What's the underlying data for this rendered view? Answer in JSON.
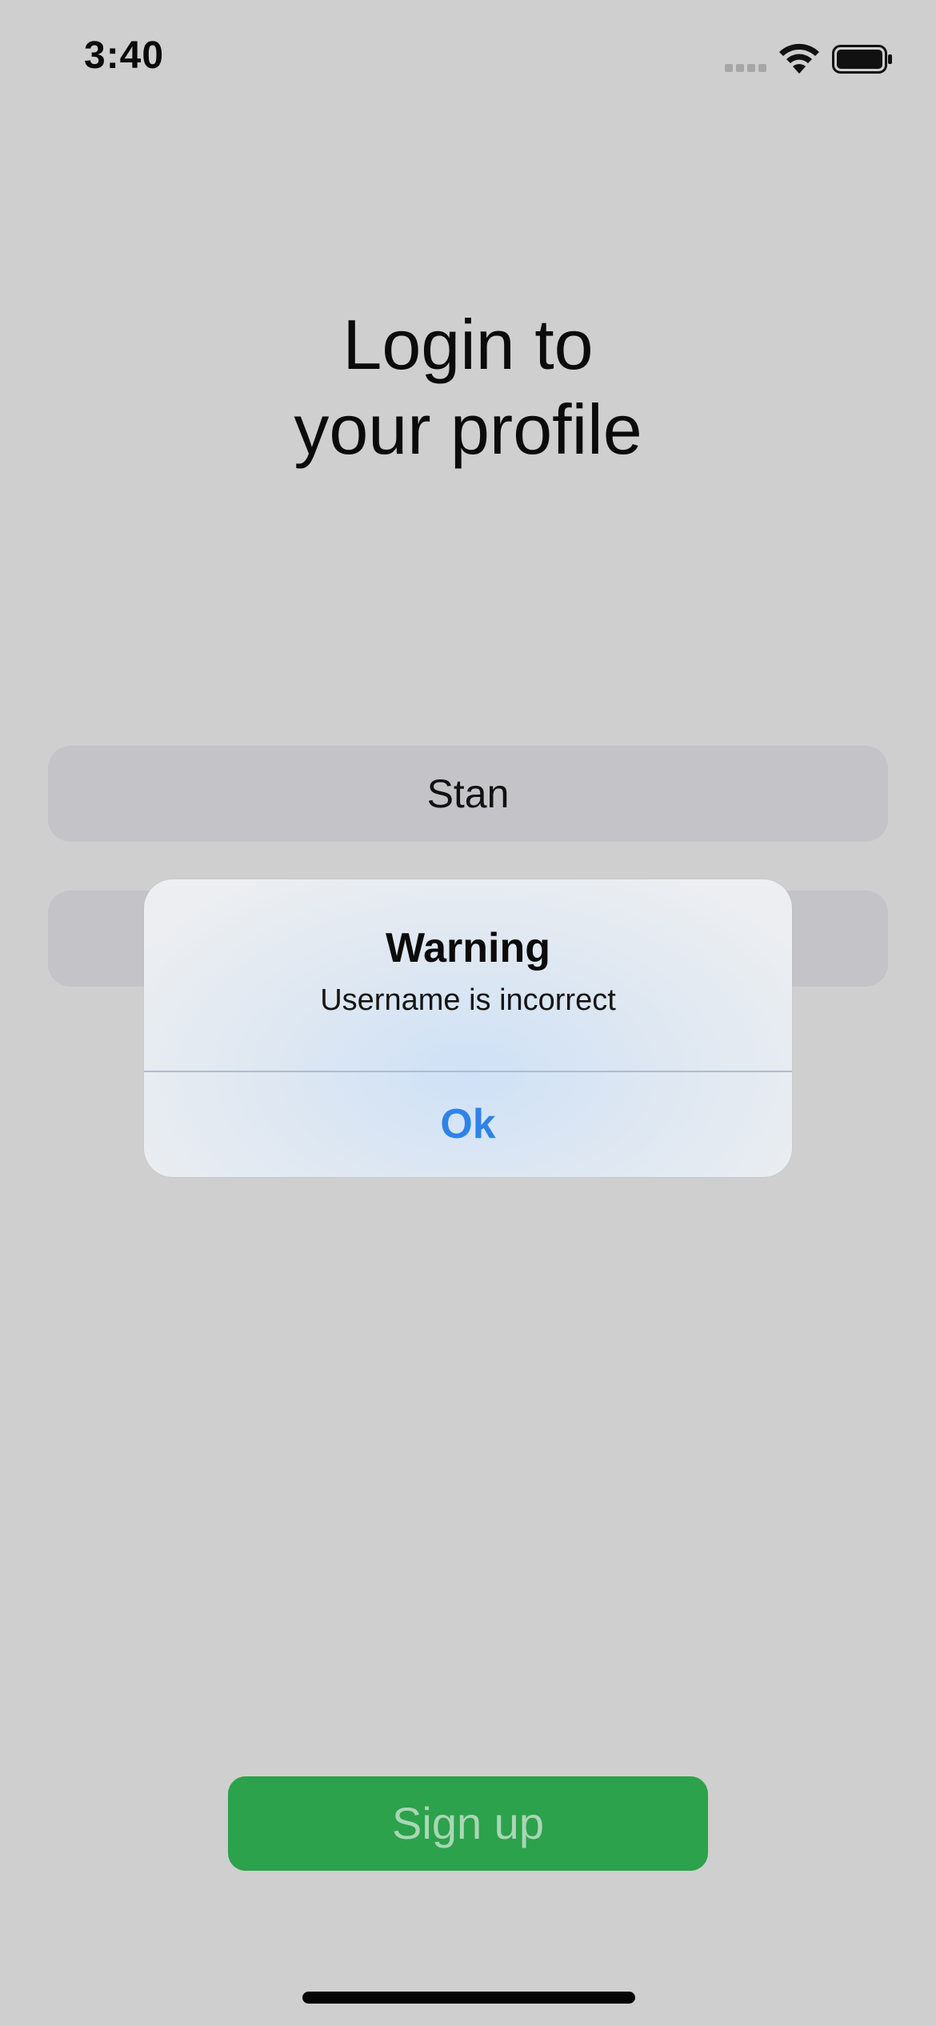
{
  "status_bar": {
    "time": "3:40",
    "icons": [
      "cellular-signal-icon",
      "wifi-icon",
      "battery-icon"
    ]
  },
  "login": {
    "title_line1": "Login to",
    "title_line2": "your profile",
    "username_value": "Stan",
    "password_value": ""
  },
  "alert": {
    "title": "Warning",
    "message": "Username is incorrect",
    "ok_label": "Ok"
  },
  "signup": {
    "label": "Sign up"
  },
  "colors": {
    "background": "#cfcfcf",
    "field": "#c4c4c8",
    "signup_button": "#2ba24b",
    "signup_text": "#aad6b5",
    "alert_action": "#2f83e6"
  }
}
